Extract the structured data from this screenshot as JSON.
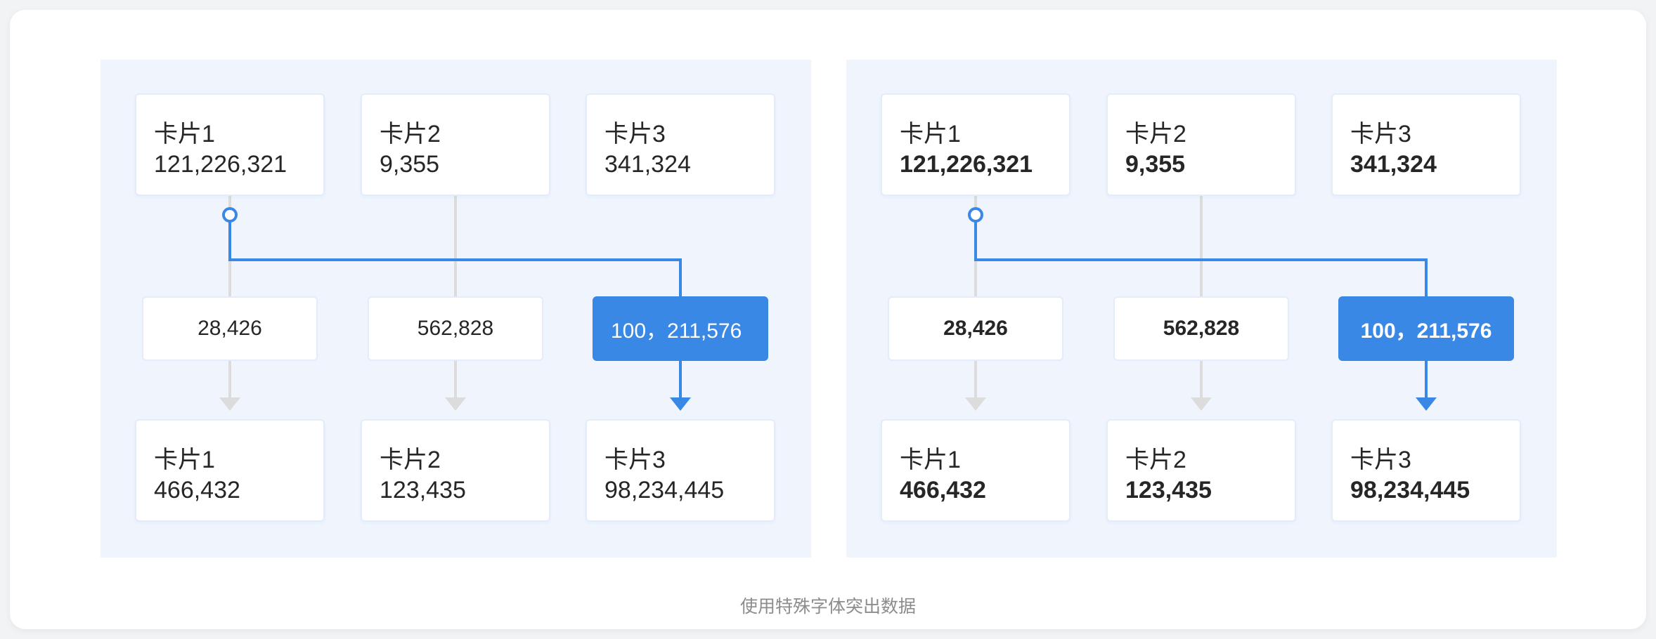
{
  "caption": "使用特殊字体突出数据",
  "colors": {
    "accent": "#3a88e6",
    "connector_gray": "#dcdcdc",
    "panel_bg": "#f0f5fd"
  },
  "panels": [
    {
      "style": "regular",
      "top_cards": [
        {
          "title": "卡片1",
          "value": "121,226,321"
        },
        {
          "title": "卡片2",
          "value": "9,355"
        },
        {
          "title": "卡片3",
          "value": "341,324"
        }
      ],
      "middle": [
        {
          "value": "28,426",
          "active": false
        },
        {
          "value": "562,828",
          "active": false
        },
        {
          "value": "100，211,576",
          "active": true
        }
      ],
      "bottom_cards": [
        {
          "title": "卡片1",
          "value": "466,432"
        },
        {
          "title": "卡片2",
          "value": "123,435"
        },
        {
          "title": "卡片3",
          "value": "98,234,445"
        }
      ]
    },
    {
      "style": "bold",
      "top_cards": [
        {
          "title": "卡片1",
          "value": "121,226,321"
        },
        {
          "title": "卡片2",
          "value": "9,355"
        },
        {
          "title": "卡片3",
          "value": "341,324"
        }
      ],
      "middle": [
        {
          "value": "28,426",
          "active": false
        },
        {
          "value": "562,828",
          "active": false
        },
        {
          "value": "100，211,576",
          "active": true
        }
      ],
      "bottom_cards": [
        {
          "title": "卡片1",
          "value": "466,432"
        },
        {
          "title": "卡片2",
          "value": "123,435"
        },
        {
          "title": "卡片3",
          "value": "98,234,445"
        }
      ]
    }
  ]
}
